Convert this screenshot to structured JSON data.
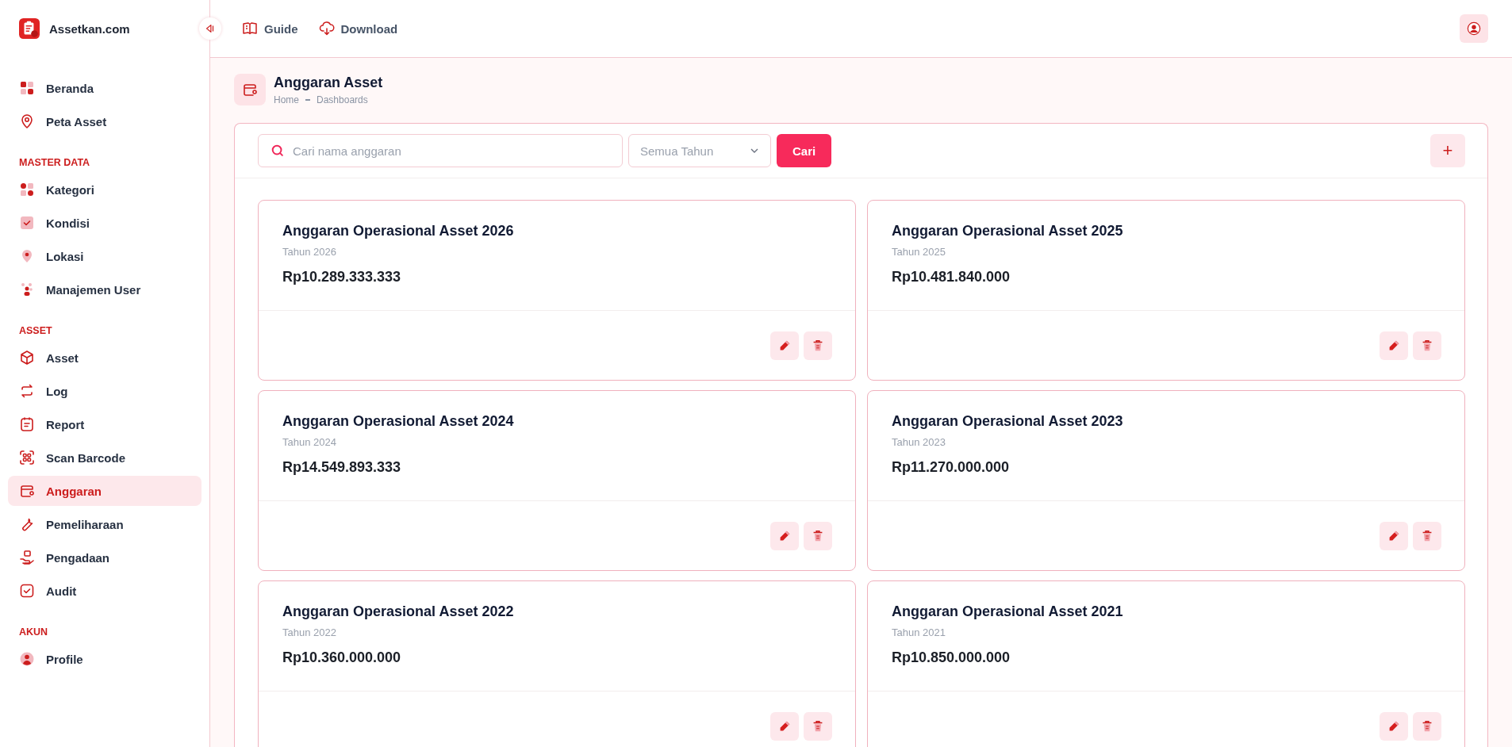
{
  "brand": {
    "name": "Assetkan.com"
  },
  "sidebar": {
    "sections": [
      {
        "items": [
          {
            "label": "Beranda",
            "selected": false
          },
          {
            "label": "Peta Asset",
            "selected": false
          }
        ]
      },
      {
        "heading": "MASTER DATA",
        "items": [
          {
            "label": "Kategori",
            "selected": false
          },
          {
            "label": "Kondisi",
            "selected": false
          },
          {
            "label": "Lokasi",
            "selected": false
          },
          {
            "label": "Manajemen User",
            "selected": false
          }
        ]
      },
      {
        "heading": "ASSET",
        "items": [
          {
            "label": "Asset",
            "selected": false
          },
          {
            "label": "Log",
            "selected": false
          },
          {
            "label": "Report",
            "selected": false
          },
          {
            "label": "Scan Barcode",
            "selected": false
          },
          {
            "label": "Anggaran",
            "selected": true
          },
          {
            "label": "Pemeliharaan",
            "selected": false
          },
          {
            "label": "Pengadaan",
            "selected": false
          },
          {
            "label": "Audit",
            "selected": false
          }
        ]
      },
      {
        "heading": "AKUN",
        "items": [
          {
            "label": "Profile",
            "selected": false
          }
        ]
      }
    ]
  },
  "topbar": {
    "links": [
      "Guide",
      "Download"
    ]
  },
  "page": {
    "title": "Anggaran Asset",
    "breadcrumb": [
      "Home",
      "Dashboards"
    ]
  },
  "toolbar": {
    "search": {
      "placeholder": "Cari nama anggaran"
    },
    "year_select": {
      "value": "Semua Tahun"
    },
    "search_button": "Cari",
    "add_button": "+"
  },
  "budgets": [
    {
      "title": "Anggaran Operasional Asset 2026",
      "year": "Tahun 2026",
      "amount": "Rp10.289.333.333"
    },
    {
      "title": "Anggaran Operasional Asset 2025",
      "year": "Tahun 2025",
      "amount": "Rp10.481.840.000"
    },
    {
      "title": "Anggaran Operasional Asset 2024",
      "year": "Tahun 2024",
      "amount": "Rp14.549.893.333"
    },
    {
      "title": "Anggaran Operasional Asset 2023",
      "year": "Tahun 2023",
      "amount": "Rp11.270.000.000"
    },
    {
      "title": "Anggaran Operasional Asset 2022",
      "year": "Tahun 2022",
      "amount": "Rp10.360.000.000"
    },
    {
      "title": "Anggaran Operasional Asset 2021",
      "year": "Tahun 2021",
      "amount": "Rp10.850.000.000"
    }
  ]
}
